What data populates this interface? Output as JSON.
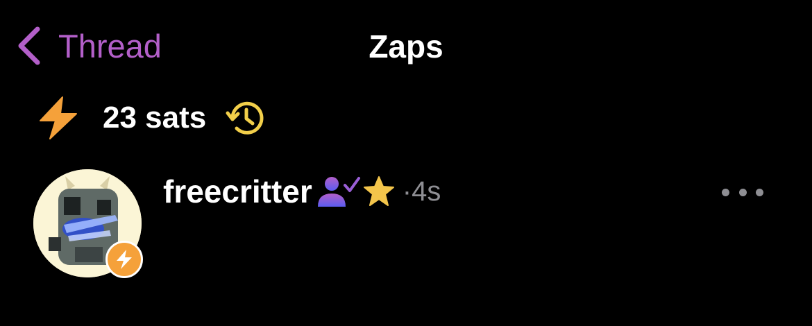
{
  "nav": {
    "back_label": "Thread",
    "title": "Zaps"
  },
  "summary": {
    "total": "23 sats"
  },
  "zaps": [
    {
      "name": "freecritter",
      "separator": "·",
      "time": "4s"
    }
  ],
  "colors": {
    "accent": "#b35fc9",
    "zap_orange": "#f5a13a",
    "history_yellow": "#f2cf4a",
    "verified_purple": "#8b5cf6",
    "muted": "#8e8e93",
    "background": "#000000"
  },
  "icons": {
    "back": "chevron-left-icon",
    "zap": "lightning-icon",
    "history": "history-clock-icon",
    "verified": "verified-user-icon",
    "star": "star-icon",
    "more": "ellipsis-icon"
  }
}
